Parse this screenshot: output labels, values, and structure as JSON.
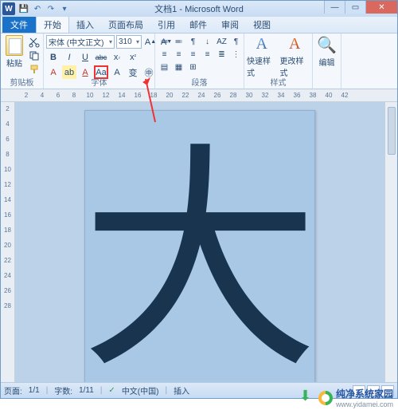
{
  "title": "文档1 - Microsoft Word",
  "qat": {
    "save": "💾",
    "undo": "↶",
    "redo": "↷",
    "more": "▾"
  },
  "winbtns": {
    "min": "—",
    "max": "▭",
    "close": "✕"
  },
  "tabs": {
    "file": "文件",
    "items": [
      "开始",
      "插入",
      "页面布局",
      "引用",
      "邮件",
      "审阅",
      "视图"
    ],
    "active": 0
  },
  "ribbon": {
    "clipboard": {
      "paste": "粘贴",
      "label": "剪贴板"
    },
    "font": {
      "name": "宋体 (中文正文)",
      "size": "310",
      "grow": "A",
      "growSup": "▲",
      "shrink": "A",
      "shrinkSup": "▼",
      "bold": "B",
      "italic": "I",
      "underline": "U",
      "strike": "abc",
      "sub": "x",
      "subSup": "₂",
      "sup": "x",
      "supSup": "²",
      "case": "Aa",
      "clear": "A",
      "effects": "A",
      "highlight": "ab",
      "color": "A",
      "ime": "变",
      "circled": "㊥",
      "label": "字体"
    },
    "para": {
      "row1": [
        "≔",
        "≕",
        "¶",
        "↓",
        "AZ",
        "¶"
      ],
      "row2": [
        "≡",
        "≡",
        "≡",
        "≡",
        "≣",
        "⋮"
      ],
      "row3": [
        "▤",
        "▦",
        "⊞"
      ],
      "label": "段落"
    },
    "styles": {
      "quick": "快速样式",
      "change": "更改样式",
      "label": "样式"
    },
    "edit": {
      "title": "编辑",
      "find": "🔍"
    }
  },
  "rulerH": [
    "2",
    "4",
    "6",
    "8",
    "10",
    "12",
    "14",
    "16",
    "18",
    "20",
    "22",
    "24",
    "26",
    "28",
    "30",
    "32",
    "34",
    "36",
    "38",
    "40",
    "42"
  ],
  "rulerV": [
    "2",
    "4",
    "6",
    "8",
    "10",
    "12",
    "14",
    "16",
    "18",
    "20",
    "22",
    "24",
    "26",
    "28"
  ],
  "doc": {
    "char": "大"
  },
  "status": {
    "page_lbl": "页面:",
    "page_val": "1/1",
    "words_lbl": "字数:",
    "words_val": "1/11",
    "proof": "✓",
    "lang": "中文(中国)",
    "insert": "插入"
  },
  "watermark": {
    "brand": "纯净系统家园",
    "url": "www.yidamei.com"
  }
}
